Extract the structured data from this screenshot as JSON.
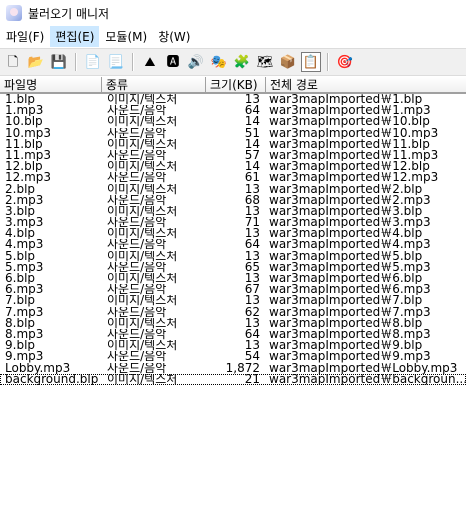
{
  "window": {
    "title": "불러오기 매니저"
  },
  "menu": [
    {
      "label": "파일(F)"
    },
    {
      "label": "편집(E)"
    },
    {
      "label": "모듈(M)"
    },
    {
      "label": "창(W)"
    }
  ],
  "toolbar": [
    {
      "name": "new-file-icon",
      "glyph": "🗋"
    },
    {
      "name": "open-folder-icon",
      "glyph": "📂"
    },
    {
      "name": "save-icon",
      "glyph": "💾"
    },
    {
      "name": "import-file-icon",
      "glyph": "📄"
    },
    {
      "name": "export-file-icon",
      "glyph": "📃"
    },
    {
      "name": "terrain-editor-icon",
      "glyph": "⛰"
    },
    {
      "name": "unit-editor-icon",
      "glyph": "🅰"
    },
    {
      "name": "sound-editor-icon",
      "glyph": "🔊"
    },
    {
      "name": "object-editor-icon",
      "glyph": "🎭"
    },
    {
      "name": "trigger-editor-icon",
      "glyph": "🧩"
    },
    {
      "name": "ai-editor-icon",
      "glyph": "🗺"
    },
    {
      "name": "object-manager-icon",
      "glyph": "📦"
    },
    {
      "name": "import-manager-icon",
      "glyph": "📋"
    },
    {
      "name": "test-map-icon",
      "glyph": "🎯"
    }
  ],
  "columns": [
    "파일명",
    "종류",
    "크기(KB)",
    "전체 경로"
  ],
  "files": [
    [
      "1.blp",
      "이미지/텍스처",
      "13",
      "war3mapImported￦1.blp"
    ],
    [
      "1.mp3",
      "사운드/음악",
      "64",
      "war3mapImported￦1.mp3"
    ],
    [
      "10.blp",
      "이미지/텍스처",
      "14",
      "war3mapImported￦10.blp"
    ],
    [
      "10.mp3",
      "사운드/음악",
      "51",
      "war3mapImported￦10.mp3"
    ],
    [
      "11.blp",
      "이미지/텍스처",
      "14",
      "war3mapImported￦11.blp"
    ],
    [
      "11.mp3",
      "사운드/음악",
      "57",
      "war3mapImported￦11.mp3"
    ],
    [
      "12.blp",
      "이미지/텍스처",
      "14",
      "war3mapImported￦12.blp"
    ],
    [
      "12.mp3",
      "사운드/음악",
      "61",
      "war3mapImported￦12.mp3"
    ],
    [
      "2.blp",
      "이미지/텍스처",
      "13",
      "war3mapImported￦2.blp"
    ],
    [
      "2.mp3",
      "사운드/음악",
      "68",
      "war3mapImported￦2.mp3"
    ],
    [
      "3.blp",
      "이미지/텍스처",
      "13",
      "war3mapImported￦3.blp"
    ],
    [
      "3.mp3",
      "사운드/음악",
      "71",
      "war3mapImported￦3.mp3"
    ],
    [
      "4.blp",
      "이미지/텍스처",
      "13",
      "war3mapImported￦4.blp"
    ],
    [
      "4.mp3",
      "사운드/음악",
      "64",
      "war3mapImported￦4.mp3"
    ],
    [
      "5.blp",
      "이미지/텍스처",
      "13",
      "war3mapImported￦5.blp"
    ],
    [
      "5.mp3",
      "사운드/음악",
      "65",
      "war3mapImported￦5.mp3"
    ],
    [
      "6.blp",
      "이미지/텍스처",
      "13",
      "war3mapImported￦6.blp"
    ],
    [
      "6.mp3",
      "사운드/음악",
      "67",
      "war3mapImported￦6.mp3"
    ],
    [
      "7.blp",
      "이미지/텍스처",
      "13",
      "war3mapImported￦7.blp"
    ],
    [
      "7.mp3",
      "사운드/음악",
      "62",
      "war3mapImported￦7.mp3"
    ],
    [
      "8.blp",
      "이미지/텍스처",
      "13",
      "war3mapImported￦8.blp"
    ],
    [
      "8.mp3",
      "사운드/음악",
      "64",
      "war3mapImported￦8.mp3"
    ],
    [
      "9.blp",
      "이미지/텍스처",
      "13",
      "war3mapImported￦9.blp"
    ],
    [
      "9.mp3",
      "사운드/음악",
      "54",
      "war3mapImported￦9.mp3"
    ],
    [
      "Lobby.mp3",
      "사운드/음악",
      "1,872",
      "war3mapImported￦Lobby.mp3"
    ],
    [
      "background.blp",
      "이미지/텍스처",
      "21",
      "war3mapImported￦backgroun..."
    ]
  ]
}
